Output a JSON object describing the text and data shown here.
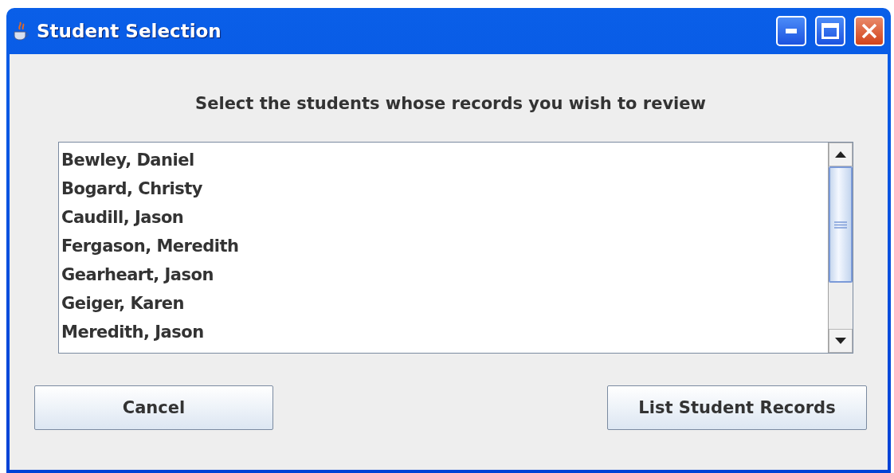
{
  "window": {
    "title": "Student Selection"
  },
  "prompt": "Select the students whose records you wish to review",
  "students": [
    {
      "name": "Bewley, Daniel",
      "selected": false
    },
    {
      "name": "Bogard, Christy",
      "selected": false
    },
    {
      "name": "Caudill, Jason",
      "selected": false
    },
    {
      "name": "Fergason, Meredith",
      "selected": false
    },
    {
      "name": "Gearheart, Jason",
      "selected": false
    },
    {
      "name": "Geiger, Karen",
      "selected": false
    },
    {
      "name": "Meredith, Jason",
      "selected": false
    }
  ],
  "buttons": [
    {
      "label": "Cancel"
    },
    {
      "label": "List Student Records"
    }
  ]
}
